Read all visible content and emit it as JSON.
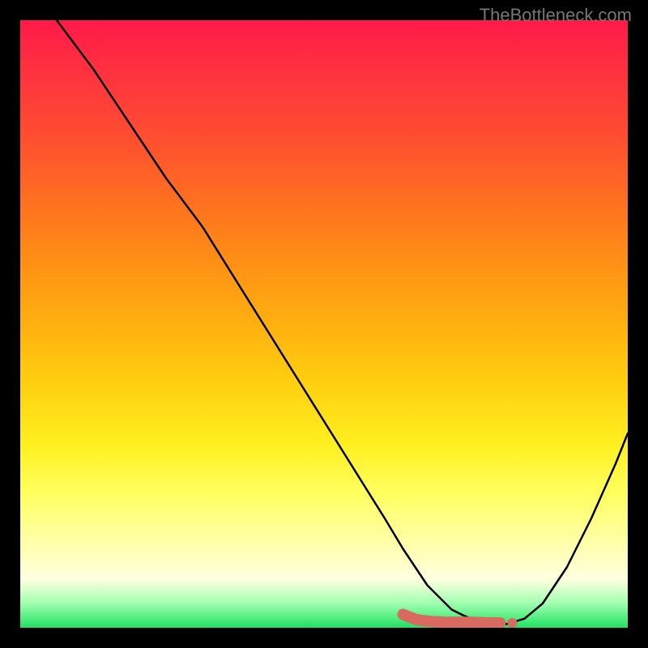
{
  "watermark": "TheBottleneck.com",
  "chart_data": {
    "type": "line",
    "title": "",
    "xlabel": "",
    "ylabel": "",
    "xlim": [
      0,
      100
    ],
    "ylim": [
      0,
      100
    ],
    "series": [
      {
        "name": "bottleneck-curve",
        "x": [
          6,
          12,
          18,
          24,
          27,
          30,
          35,
          40,
          45,
          50,
          55,
          60,
          63,
          65,
          67,
          69,
          71,
          73,
          75,
          77,
          80,
          83,
          86,
          90,
          94,
          98,
          100
        ],
        "y": [
          100,
          92,
          83,
          74,
          70,
          66,
          58,
          50,
          42,
          34,
          26,
          18,
          13,
          10,
          7,
          5,
          3,
          2,
          1.2,
          0.8,
          0.6,
          1.5,
          4,
          10,
          18,
          27,
          32
        ]
      }
    ],
    "markers": {
      "name": "optimal-zone",
      "points": [
        {
          "x": 63,
          "y": 2.2
        },
        {
          "x": 64,
          "y": 1.8
        },
        {
          "x": 65,
          "y": 1.4
        },
        {
          "x": 66,
          "y": 1.2
        },
        {
          "x": 68,
          "y": 1.0
        },
        {
          "x": 70,
          "y": 0.9
        },
        {
          "x": 72,
          "y": 0.9
        },
        {
          "x": 74,
          "y": 0.9
        },
        {
          "x": 77,
          "y": 0.8
        },
        {
          "x": 79,
          "y": 0.8
        }
      ]
    },
    "gradient_stops": [
      {
        "pos": 0,
        "color": "#ff1a4a"
      },
      {
        "pos": 50,
        "color": "#ffd010"
      },
      {
        "pos": 92,
        "color": "#ffffe0"
      },
      {
        "pos": 100,
        "color": "#20e060"
      }
    ]
  }
}
